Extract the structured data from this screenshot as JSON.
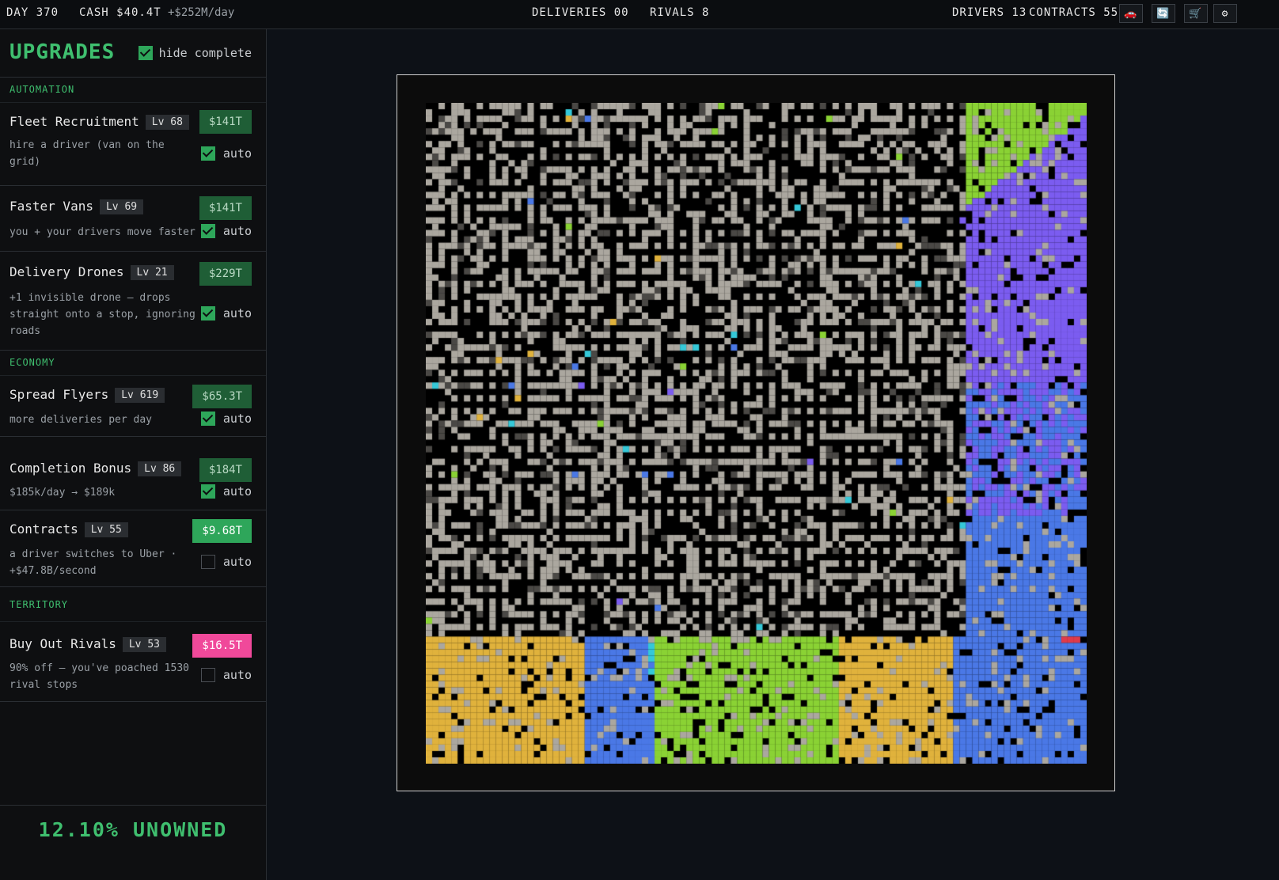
{
  "topbar": {
    "day": "DAY 370",
    "cash": "CASH $40.4T",
    "rate": "+$252M/day",
    "deliveries": "DELIVERIES 00",
    "rivals": "RIVALS 8",
    "drivers": "DRIVERS 13",
    "contracts": "CONTRACTS 55",
    "buttons": [
      {
        "icon": "car-icon",
        "glyph": "🚗"
      },
      {
        "icon": "swap-icon",
        "glyph": "🔄"
      },
      {
        "icon": "cart-icon",
        "glyph": "🛒"
      },
      {
        "icon": "gear-icon",
        "glyph": "⚙"
      }
    ]
  },
  "sidebar": {
    "title": "UPGRADES",
    "hide_complete": "hide complete",
    "hide_complete_checked": true,
    "sections": {
      "automation": "AUTOMATION",
      "economy": "ECONOMY",
      "territory": "TERRITORY"
    },
    "upgrades": [
      {
        "name": "Fleet Recruitment",
        "level": "Lv 68",
        "price": "$141T",
        "price_style": "dark",
        "desc": "hire a driver (van on the grid)",
        "auto": "auto",
        "auto_checked": true
      },
      {
        "name": "Faster Vans",
        "level": "Lv 69",
        "price": "$141T",
        "price_style": "dark",
        "desc": "you + your drivers move faster",
        "auto": "auto",
        "auto_checked": true
      },
      {
        "name": "Delivery Drones",
        "level": "Lv 21",
        "price": "$229T",
        "price_style": "dark",
        "desc": "+1 invisible drone — drops straight onto a stop, ignoring roads",
        "auto": "auto",
        "auto_checked": true
      },
      {
        "name": "Spread Flyers",
        "level": "Lv 619",
        "price": "$65.3T",
        "price_style": "dark",
        "desc": "more deliveries per day",
        "auto": "auto",
        "auto_checked": true
      },
      {
        "name": "Completion Bonus",
        "level": "Lv 86",
        "price": "$184T",
        "price_style": "dark",
        "desc": "$185k/day → $189k",
        "auto": "auto",
        "auto_checked": true
      },
      {
        "name": "Contracts",
        "level": "Lv 55",
        "price": "$9.68T",
        "price_style": "bright",
        "desc": "a driver switches to Uber · +$47.8B/second",
        "auto": "auto",
        "auto_checked": false
      },
      {
        "name": "Buy Out Rivals",
        "level": "Lv 53",
        "price": "$16.5T",
        "price_style": "pink",
        "desc": "90% off — you've poached 1530 rival stops",
        "auto": "auto",
        "auto_checked": false
      }
    ],
    "unowned": "12.10% UNOWNED"
  },
  "map": {
    "grid_size": 104,
    "unowned_fraction": 0.121,
    "colors": {
      "road": "#000000",
      "block": "#aba79f",
      "block_dark": "#4a4845",
      "violet": "#7b5cf0",
      "blue": "#4a78e6",
      "green": "#8ad234",
      "yellow": "#e0b23c",
      "cyan": "#35c8d8",
      "red": "#e03a4a"
    }
  }
}
